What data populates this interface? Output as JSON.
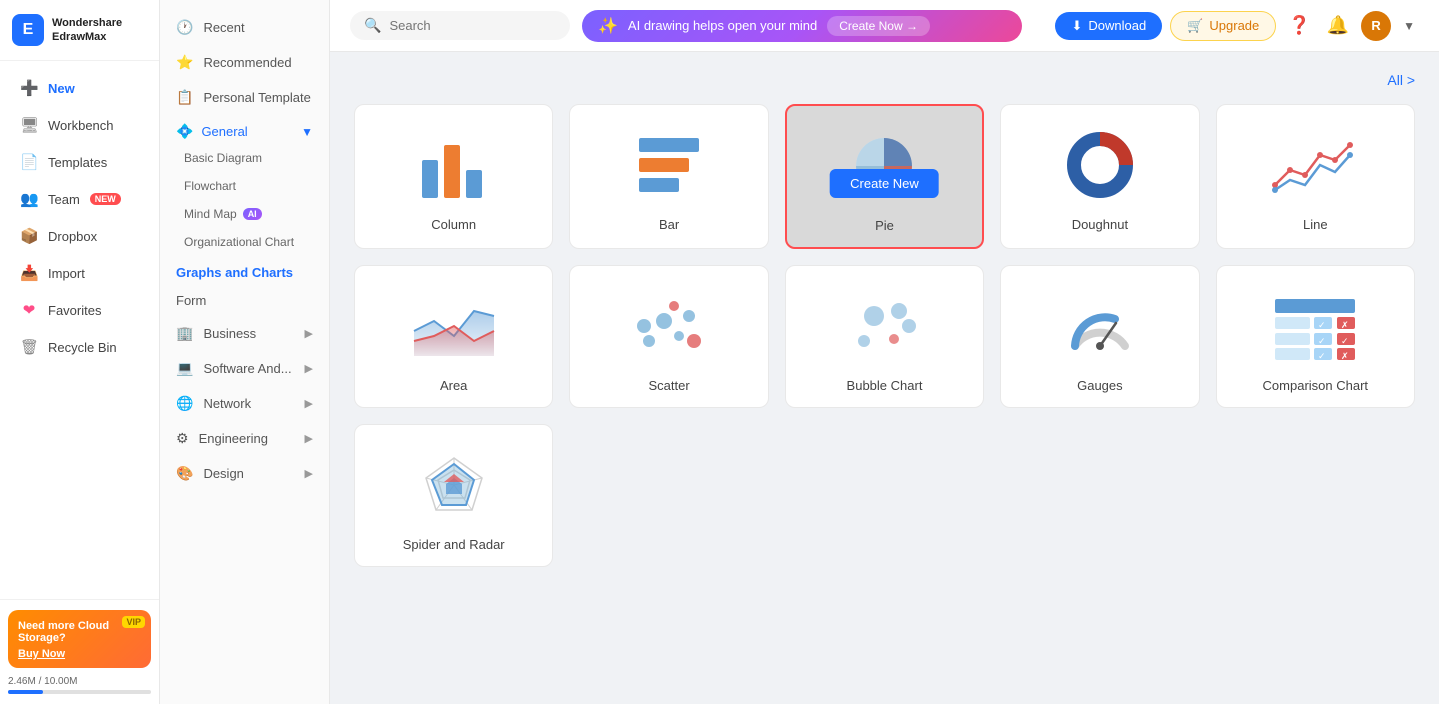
{
  "app": {
    "name": "Wondershare",
    "subname": "EdrawMax"
  },
  "sidebar": {
    "new_label": "New",
    "items": [
      {
        "id": "workbench",
        "label": "Workbench",
        "icon": "🖥"
      },
      {
        "id": "templates",
        "label": "Templates",
        "icon": "📄"
      },
      {
        "id": "team",
        "label": "Team",
        "icon": "👥",
        "badge": "NEW"
      },
      {
        "id": "dropbox",
        "label": "Dropbox",
        "icon": "📦"
      },
      {
        "id": "import",
        "label": "Import",
        "icon": "📥"
      },
      {
        "id": "favorites",
        "label": "Favorites",
        "icon": "❤"
      },
      {
        "id": "recycle",
        "label": "Recycle Bin",
        "icon": "🗑"
      }
    ],
    "storage_text": "2.46M / 10.00M",
    "cloud_title": "Need more Cloud Storage?",
    "cloud_cta": "Buy Now",
    "vip_label": "VIP"
  },
  "second_panel": {
    "items": [
      {
        "id": "recent",
        "label": "Recent",
        "icon": "🕐"
      },
      {
        "id": "recommended",
        "label": "Recommended",
        "icon": "⭐"
      },
      {
        "id": "personal",
        "label": "Personal Template",
        "icon": "📋"
      }
    ],
    "sections": [
      {
        "label": "General",
        "active": false,
        "expanded": true,
        "subitems": [
          {
            "label": "Basic Diagram"
          },
          {
            "label": "Flowchart"
          },
          {
            "label": "Mind Map",
            "badge": "AI"
          },
          {
            "label": "Organizational Chart"
          }
        ]
      },
      {
        "label": "Graphs and Charts",
        "active": true,
        "expanded": false,
        "subitems": []
      },
      {
        "label": "Form",
        "active": false,
        "expanded": false,
        "subitems": []
      }
    ],
    "expandable": [
      {
        "id": "business",
        "label": "Business"
      },
      {
        "id": "software",
        "label": "Software And..."
      },
      {
        "id": "network",
        "label": "Network"
      },
      {
        "id": "engineering",
        "label": "Engineering"
      },
      {
        "id": "design",
        "label": "Design"
      }
    ]
  },
  "header": {
    "search_placeholder": "Search",
    "ai_banner_text": "AI drawing helps open your mind",
    "ai_banner_cta": "Create Now →",
    "download_label": "Download",
    "upgrade_label": "Upgrade",
    "all_label": "All >"
  },
  "charts": {
    "row1": [
      {
        "id": "column",
        "label": "Column",
        "selected": false
      },
      {
        "id": "bar",
        "label": "Bar",
        "selected": false
      },
      {
        "id": "pie",
        "label": "Pie",
        "selected": true,
        "create_new": "Create New"
      },
      {
        "id": "doughnut",
        "label": "Doughnut",
        "selected": false
      },
      {
        "id": "line",
        "label": "Line",
        "selected": false
      }
    ],
    "row2": [
      {
        "id": "area",
        "label": "Area",
        "selected": false
      },
      {
        "id": "scatter",
        "label": "Scatter",
        "selected": false
      },
      {
        "id": "bubble",
        "label": "Bubble Chart",
        "selected": false
      },
      {
        "id": "gauges",
        "label": "Gauges",
        "selected": false
      },
      {
        "id": "comparison",
        "label": "Comparison Chart",
        "selected": false
      }
    ],
    "row3": [
      {
        "id": "spider",
        "label": "Spider and Radar",
        "selected": false
      }
    ]
  }
}
